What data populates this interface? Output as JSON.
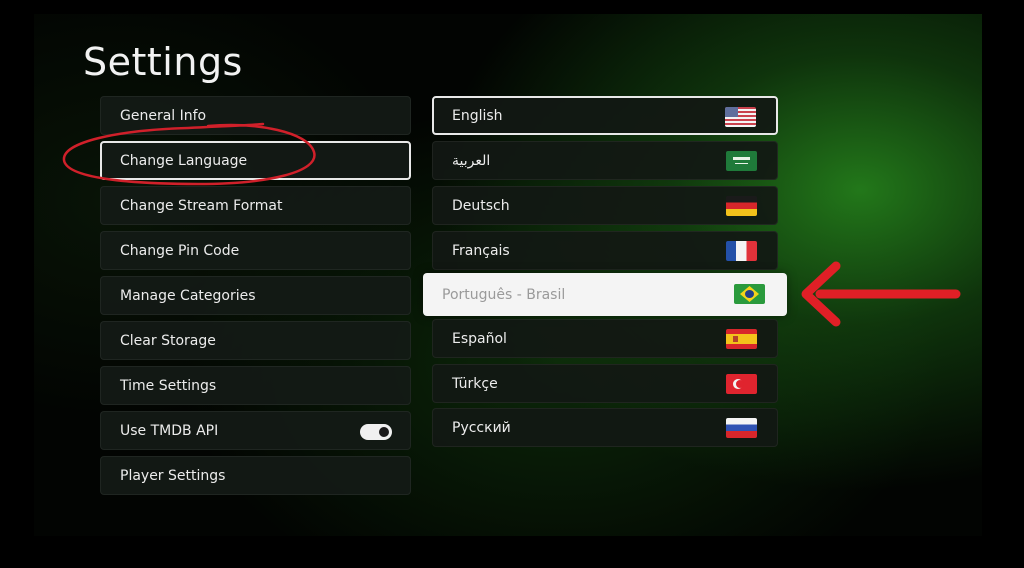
{
  "page": {
    "title": "Settings"
  },
  "settings_menu": {
    "items": [
      {
        "label": "General Info"
      },
      {
        "label": "Change Language"
      },
      {
        "label": "Change Stream Format"
      },
      {
        "label": "Change Pin Code"
      },
      {
        "label": "Manage Categories"
      },
      {
        "label": "Clear Storage"
      },
      {
        "label": "Time Settings"
      },
      {
        "label": "Use TMDB API",
        "toggle": "on"
      },
      {
        "label": "Player Settings"
      }
    ],
    "active_item": "Change Language"
  },
  "language_list": {
    "items": [
      {
        "label": "English",
        "flag": "us-flag-icon"
      },
      {
        "label": "العربية",
        "flag": "saudi-arabia-flag-icon"
      },
      {
        "label": "Deutsch",
        "flag": "germany-flag-icon"
      },
      {
        "label": "Français",
        "flag": "france-flag-icon"
      },
      {
        "label": "Português - Brasil",
        "flag": "brazil-flag-icon"
      },
      {
        "label": "Español",
        "flag": "spain-flag-icon"
      },
      {
        "label": "Türkçe",
        "flag": "turkey-flag-icon"
      },
      {
        "label": "Русский",
        "flag": "russia-flag-icon"
      }
    ],
    "selected_language": "English",
    "focused_language": "Português - Brasil"
  },
  "annotations": {
    "circle_color": "#d0202a",
    "arrow_color": "#e01f26"
  },
  "colors": {
    "background": "#020402",
    "accent_green": "#288c1e",
    "item_background": "#141a16",
    "focus_background": "#f4f4f4"
  }
}
